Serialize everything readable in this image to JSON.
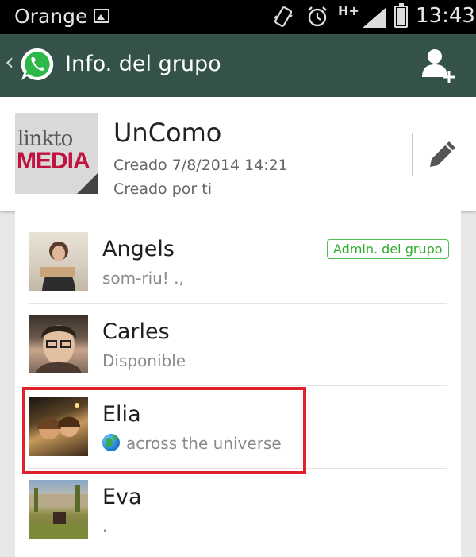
{
  "status_bar": {
    "carrier": "Orange",
    "network": "H+",
    "time": "13:43",
    "icons": [
      "gallery-icon",
      "vibrate-icon",
      "alarm-icon",
      "signal-icon",
      "battery-charging-icon"
    ]
  },
  "action_bar": {
    "back_glyph": "‹",
    "title": "Info. del grupo",
    "icons": [
      "whatsapp-logo-icon",
      "add-participant-icon"
    ]
  },
  "group": {
    "photo_text_line1": "linkto",
    "photo_text_line2": "MEDIA",
    "name": "UnComo",
    "created": "Creado 7/8/2014 14:21",
    "created_by": "Creado por ti"
  },
  "participants": [
    {
      "name": "Angels",
      "status": "som-riu! .,",
      "badge": "Admin. del grupo"
    },
    {
      "name": "Carles",
      "status": "Disponible"
    },
    {
      "name": "Elia",
      "status": "across the universe",
      "status_icon": "globe-icon",
      "highlighted": true
    },
    {
      "name": "Eva",
      "status": "."
    }
  ],
  "colors": {
    "action_bar": "#34524a",
    "admin_badge": "#2eaa2e",
    "highlight": "#e0202a"
  }
}
